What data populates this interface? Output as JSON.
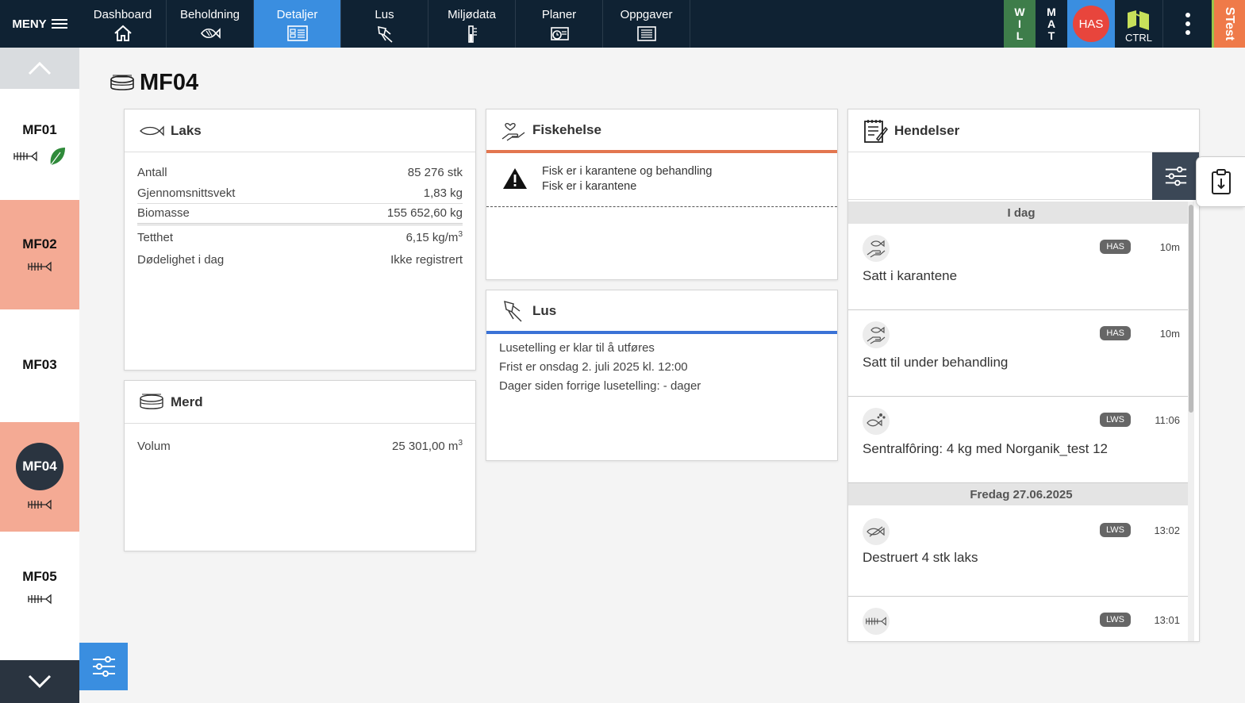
{
  "topbar": {
    "menu_label": "MENY",
    "tabs": [
      {
        "label": "Dashboard",
        "icon": "home-icon"
      },
      {
        "label": "Beholdning",
        "icon": "fish-icon"
      },
      {
        "label": "Detaljer",
        "icon": "details-icon",
        "active": true
      },
      {
        "label": "Lus",
        "icon": "louse-icon"
      },
      {
        "label": "Miljødata",
        "icon": "thermometer-icon"
      },
      {
        "label": "Planer",
        "icon": "plans-icon"
      },
      {
        "label": "Oppgaver",
        "icon": "tasks-icon"
      }
    ],
    "wil": [
      "W",
      "I",
      "L"
    ],
    "mat": [
      "M",
      "A",
      "T"
    ],
    "user_initials": "HAS",
    "ctrl_label": "CTRL",
    "env_label": "STest",
    "colors": {
      "bg": "#0f2233",
      "active": "#3a8ee0",
      "wil": "#3e7d4a",
      "user": "#e8453c",
      "env": "#ef7a49"
    }
  },
  "sidebar": {
    "items": [
      {
        "label": "MF01",
        "icons": [
          "fish-skeleton-icon",
          "leaf-icon"
        ],
        "alert": false
      },
      {
        "label": "MF02",
        "icons": [
          "fish-skeleton-icon"
        ],
        "alert": true
      },
      {
        "label": "MF03",
        "icons": [],
        "alert": false
      },
      {
        "label": "MF04",
        "icons": [
          "fish-skeleton-icon"
        ],
        "alert": true,
        "selected": true
      },
      {
        "label": "MF05",
        "icons": [
          "fish-skeleton-icon"
        ],
        "alert": false
      }
    ]
  },
  "page": {
    "title": "MF04"
  },
  "laks": {
    "title": "Laks",
    "rows": [
      {
        "label": "Antall",
        "value": "85 276 stk"
      },
      {
        "label": "Gjennomsnittsvekt",
        "value": "1,83 kg"
      },
      {
        "label": "Biomasse",
        "value": "155 652,60 kg"
      },
      {
        "label": "Tetthet",
        "value": "6,15 kg/m",
        "sup": "3"
      },
      {
        "label": "Dødelighet i dag",
        "value": "Ikke registrert"
      }
    ]
  },
  "merd": {
    "title": "Merd",
    "rows": [
      {
        "label": "Volum",
        "value": "25 301,00 m",
        "sup": "3"
      }
    ]
  },
  "fiskehelse": {
    "title": "Fiskehelse",
    "alert_lines": [
      "Fisk er i karantene og behandling",
      "Fisk er i karantene"
    ]
  },
  "lus": {
    "title": "Lus",
    "lines": [
      "Lusetelling er klar til å utføres",
      "Frist er onsdag 2. juli 2025 kl. 12:00",
      "Dager siden forrige lusetelling: - dager"
    ]
  },
  "hendelser": {
    "title": "Hendelser",
    "groups": [
      {
        "date": "I dag",
        "events": [
          {
            "icon": "quarantine-icon",
            "user": "HAS",
            "time": "10m",
            "text": "Satt i karantene"
          },
          {
            "icon": "quarantine-icon",
            "user": "HAS",
            "time": "10m",
            "text": "Satt til under behandling"
          },
          {
            "icon": "feeding-icon",
            "user": "LWS",
            "time": "11:06",
            "text": "Sentralfôring: 4 kg med Norganik_test 12"
          }
        ]
      },
      {
        "date": "Fredag 27.06.2025",
        "events": [
          {
            "icon": "fish-destroy-icon",
            "user": "LWS",
            "time": "13:02",
            "text": "Destruert 4 stk laks"
          },
          {
            "icon": "fish-skeleton-icon",
            "user": "LWS",
            "time": "13:01",
            "text": ""
          }
        ]
      }
    ]
  }
}
